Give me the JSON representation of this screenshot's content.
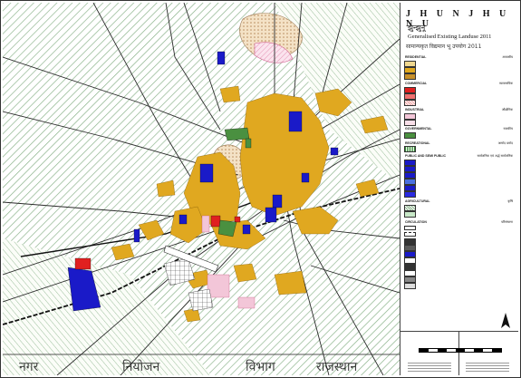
{
  "title": "J H U N J H U N U",
  "title_hindi": "झुन्झुनू",
  "subtitle": "Generalised Existing Landuse 2011",
  "subtitle_hindi": "सामान्यकृत विद्यमान भू उपयोग 2011",
  "bottom_text": {
    "left": "नगर",
    "mid1": "नियोजन",
    "mid2": "विभाग",
    "right": "राजस्थान"
  },
  "legend": {
    "sections": [
      {
        "label": "RESIDENTIAL",
        "label_hindi": "आवासीय"
      },
      {
        "label": "COMMERCIAL",
        "label_hindi": "व्यावसायिक"
      },
      {
        "label": "INDUSTRIAL",
        "label_hindi": "औद्योगिक"
      },
      {
        "label": "GOVERNMENTAL",
        "label_hindi": "राजकीय"
      },
      {
        "label": "RECREATIONAL",
        "label_hindi": "आमोद प्रमोद"
      },
      {
        "label": "PUBLIC AND SEMI PUBLIC",
        "label_hindi": "सार्वजनिक एवं अर्द्ध सार्वजनिक"
      },
      {
        "label": "AGRICULTURAL",
        "label_hindi": "कृषि"
      },
      {
        "label": "CIRCULATION",
        "label_hindi": "परिसंचरण"
      }
    ]
  },
  "colors": {
    "residential": "#e0a820",
    "commercial": "#e02020",
    "industrial": "#f3c6d8",
    "government": "#4a9040",
    "recreational": "#2e8b2e",
    "public": "#1a1ac8",
    "agricultural_hatch": "#8cb48c",
    "roads": "#333333",
    "hill": "#c4a27a"
  }
}
